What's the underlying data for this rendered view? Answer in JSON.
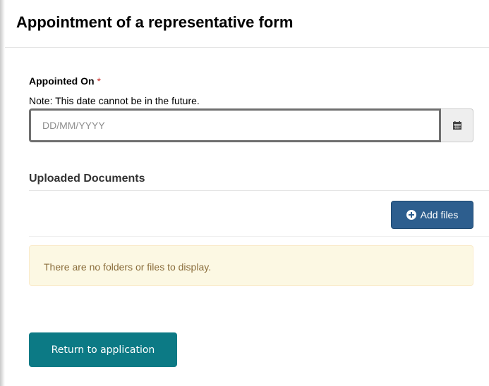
{
  "header": {
    "title": "Appointment of a representative form"
  },
  "appointed_on": {
    "label": "Appointed On",
    "required_marker": "*",
    "note": "Note: This date cannot be in the future.",
    "value": "",
    "placeholder": "DD/MM/YYYY",
    "calendar_icon": "calendar-icon"
  },
  "documents": {
    "title": "Uploaded Documents",
    "add_files_label": "Add files",
    "add_files_icon": "plus-circle-icon",
    "empty_message": "There are no folders or files to display."
  },
  "footer": {
    "return_label": "Return to application"
  },
  "colors": {
    "primary_button": "#2d5e8e",
    "return_button": "#0c7a85",
    "required": "#c9302c",
    "alert_background": "#fcf8e3",
    "alert_text": "#8a6d3b"
  }
}
